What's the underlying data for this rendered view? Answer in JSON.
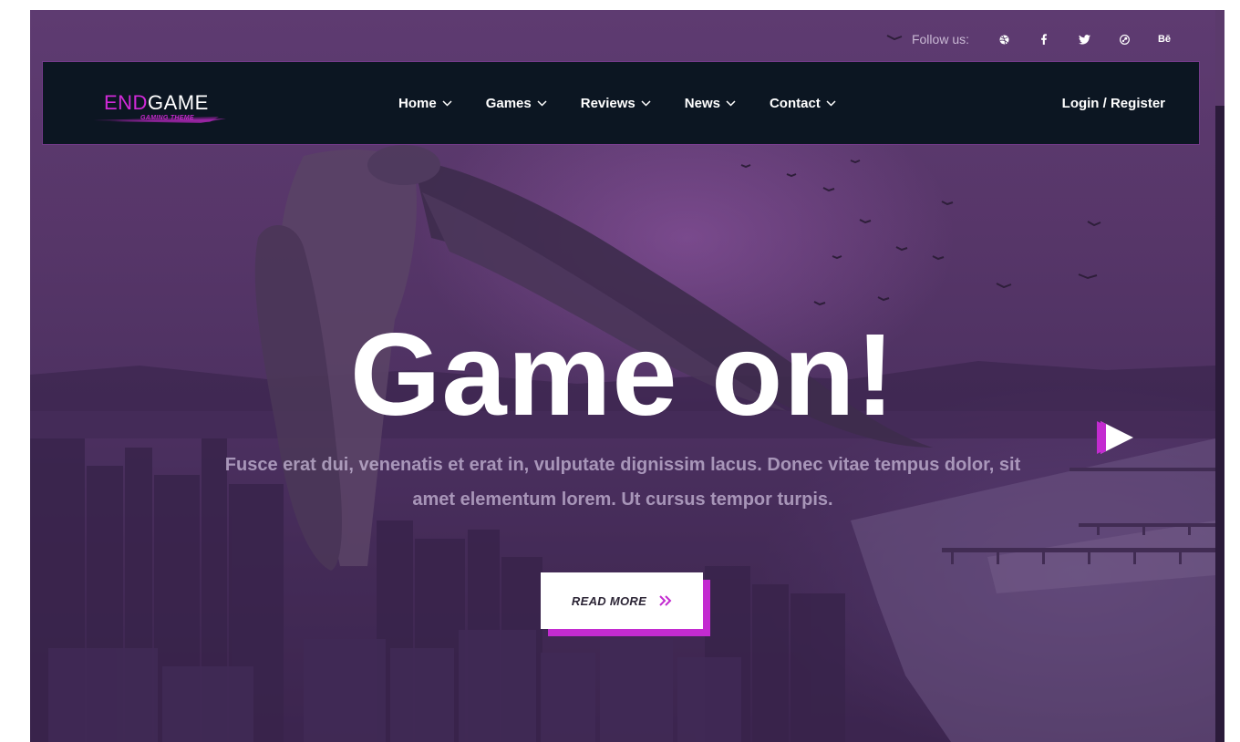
{
  "colors": {
    "accent": "#c32bd0",
    "navbar_bg": "#0c1622",
    "overlay": "#4d3161"
  },
  "topbar": {
    "follow_label": "Follow us:",
    "socials": [
      {
        "name": "dribbble-icon"
      },
      {
        "name": "facebook-icon"
      },
      {
        "name": "twitter-icon"
      },
      {
        "name": "steam-icon"
      },
      {
        "name": "behance-icon",
        "text": "Bē"
      }
    ]
  },
  "logo": {
    "part1": "END",
    "part2": "GAME",
    "tagline": "GAMING THEME"
  },
  "nav": {
    "items": [
      {
        "label": "Home",
        "icon": "chevron-down-icon"
      },
      {
        "label": "Games",
        "icon": "chevron-down-icon"
      },
      {
        "label": "Reviews",
        "icon": "chevron-down-icon"
      },
      {
        "label": "News",
        "icon": "chevron-down-icon"
      },
      {
        "label": "Contact",
        "icon": "chevron-down-icon"
      }
    ],
    "login": "Login / Register"
  },
  "hero": {
    "title": "Game on!",
    "description": "Fusce erat dui, venenatis et erat in, vulputate dignissim lacus. Donec vitae tempus dolor, sit amet elementum lorem. Ut cursus tempor turpis.",
    "button_label": "READ MORE",
    "button_icon": "double-chevron-right-icon",
    "next_slide_icon": "play-arrow-icon"
  }
}
